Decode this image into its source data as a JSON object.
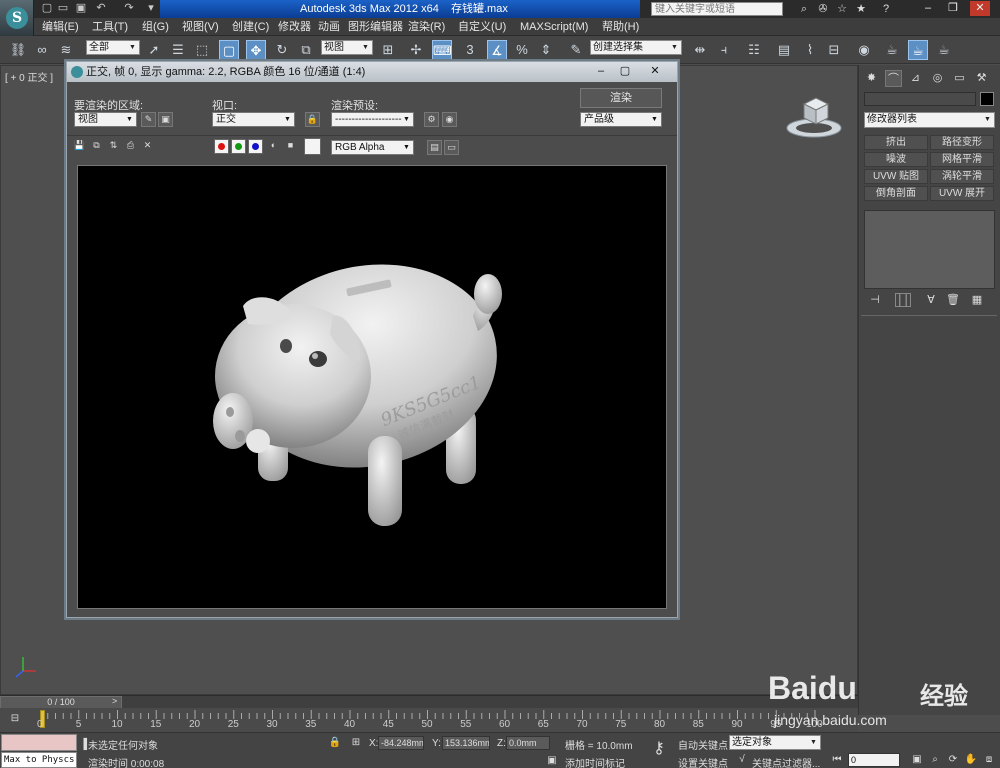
{
  "titlebar": {
    "app_title": "Autodesk 3ds Max  2012 x64",
    "file_name": "存钱罐.max",
    "search_placeholder": "键入关键字或短语"
  },
  "menu": [
    "编辑(E)",
    "工具(T)",
    "组(G)",
    "视图(V)",
    "创建(C)",
    "修改器",
    "动画",
    "图形编辑器",
    "渲染(R)",
    "自定义(U)",
    "MAXScript(M)",
    "帮助(H)"
  ],
  "toolbar": {
    "selection_filter": "全部",
    "ref_coord": "视图",
    "named_selection_placeholder": "创建选择集"
  },
  "viewport": {
    "label": "[ + 0 正交 ]"
  },
  "render_window": {
    "title": "正交, 帧 0, 显示 gamma: 2.2, RGBA 颜色 16 位/通道 (1:4)",
    "area_label": "要渲染的区域:",
    "area_value": "视图",
    "viewport_label": "视口:",
    "viewport_value": "正交",
    "preset_label": "渲染预设:",
    "preset_value": "--------------------",
    "render_button": "渲染",
    "quality_value": "产品级",
    "channel_value": "RGB Alpha",
    "render_text_1": "9KS5G5cc1",
    "render_text_2": "诚信满载财"
  },
  "command_panel": {
    "modifier_list": "修改器列表",
    "buttons": [
      "挤出",
      "路径变形",
      "噪波",
      "网格平滑",
      "UVW 贴图",
      "涡轮平滑",
      "倒角剖面",
      "UVW 展开"
    ]
  },
  "timeline": {
    "frame_display": "0 / 100",
    "ticks": [
      "0",
      "5",
      "10",
      "15",
      "20",
      "25",
      "30",
      "35",
      "40",
      "45",
      "50",
      "55",
      "60",
      "65",
      "70",
      "75",
      "80",
      "85",
      "90",
      "95",
      "100"
    ]
  },
  "status": {
    "maxscript_text": "Max to Physcs (",
    "selection_msg": "未选定任何对象",
    "render_time": "渲染时间  0:00:08",
    "x_label": "X:",
    "x_value": "-84.248mm",
    "y_label": "Y:",
    "y_value": "153.136mm",
    "z_label": "Z:",
    "z_value": "0.0mm",
    "grid": "栅格 = 10.0mm",
    "add_time_tag": "添加时间标记",
    "auto_key": "自动关键点",
    "selected_objects": "选定对象",
    "set_key": "设置关键点",
    "key_filters": "关键点过滤器...",
    "frame_value": "0"
  },
  "watermark": {
    "brand": "Baidu",
    "brand_cn": "经验",
    "url": "jingyan.baidu.com"
  },
  "colors": {
    "accent_blue": "#1b62c8",
    "viewport_bg": "#4f4f4f",
    "highlight": "#5c8fc4"
  }
}
